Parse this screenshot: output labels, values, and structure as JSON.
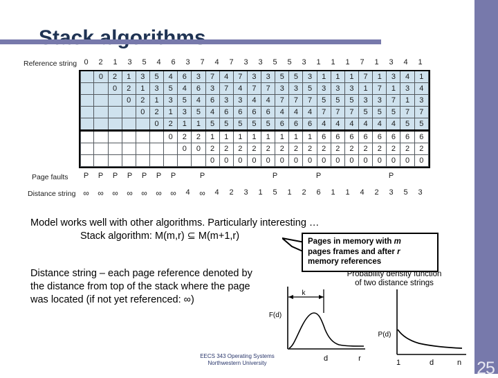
{
  "slide": {
    "title": "Stack algorithms",
    "page_number": "25",
    "accent_color": "#7779ab",
    "title_color": "#1f3353"
  },
  "figure": {
    "reference_string_label": "Reference string",
    "page_faults_label": "Page faults",
    "distance_string_label": "Distance string",
    "reference_string": [
      "0",
      "2",
      "1",
      "3",
      "5",
      "4",
      "6",
      "3",
      "7",
      "4",
      "7",
      "3",
      "3",
      "5",
      "5",
      "3",
      "1",
      "1",
      "1",
      "7",
      "1",
      "3",
      "4",
      "1"
    ],
    "page_faults": [
      "P",
      "P",
      "P",
      "P",
      "P",
      "P",
      "P",
      "",
      "P",
      "",
      "",
      "",
      "",
      "P",
      "",
      "",
      "P",
      "",
      "",
      "",
      "",
      "P",
      "",
      ""
    ],
    "distance_string": [
      "∞",
      "∞",
      "∞",
      "∞",
      "∞",
      "∞",
      "∞",
      "4",
      "∞",
      "4",
      "2",
      "3",
      "1",
      "5",
      "1",
      "2",
      "6",
      "1",
      "1",
      "4",
      "2",
      "3",
      "5",
      "3"
    ],
    "fault_marker": "P",
    "infinity_symbol": "∞",
    "memory_frames": 4,
    "rows": [
      [
        "",
        "0",
        "2",
        "1",
        "3",
        "5",
        "4",
        "6",
        "3",
        "7",
        "4",
        "7",
        "3",
        "3",
        "5",
        "5",
        "3",
        "1",
        "1",
        "1",
        "7",
        "1",
        "3",
        "4",
        "1"
      ],
      [
        "",
        "",
        "0",
        "2",
        "1",
        "3",
        "5",
        "4",
        "6",
        "3",
        "7",
        "4",
        "7",
        "7",
        "3",
        "3",
        "5",
        "3",
        "3",
        "3",
        "1",
        "7",
        "1",
        "3",
        "4"
      ],
      [
        "",
        "",
        "",
        "0",
        "2",
        "1",
        "3",
        "5",
        "4",
        "6",
        "3",
        "3",
        "4",
        "4",
        "7",
        "7",
        "7",
        "5",
        "5",
        "5",
        "3",
        "3",
        "7",
        "1",
        "3"
      ],
      [
        "",
        "",
        "",
        "",
        "0",
        "2",
        "1",
        "3",
        "5",
        "4",
        "6",
        "6",
        "6",
        "6",
        "4",
        "4",
        "4",
        "7",
        "7",
        "7",
        "5",
        "5",
        "5",
        "7",
        "7"
      ],
      [
        "",
        "",
        "",
        "",
        "",
        "0",
        "2",
        "1",
        "1",
        "5",
        "5",
        "5",
        "5",
        "5",
        "6",
        "6",
        "6",
        "4",
        "4",
        "4",
        "4",
        "4",
        "4",
        "5",
        "5"
      ],
      [
        "",
        "",
        "",
        "",
        "",
        "",
        "0",
        "2",
        "2",
        "1",
        "1",
        "1",
        "1",
        "1",
        "1",
        "1",
        "1",
        "6",
        "6",
        "6",
        "6",
        "6",
        "6",
        "6",
        "6"
      ],
      [
        "",
        "",
        "",
        "",
        "",
        "",
        "",
        "0",
        "0",
        "2",
        "2",
        "2",
        "2",
        "2",
        "2",
        "2",
        "2",
        "2",
        "2",
        "2",
        "2",
        "2",
        "2",
        "2",
        "2"
      ],
      [
        "",
        "",
        "",
        "",
        "",
        "",
        "",
        "",
        "",
        "0",
        "0",
        "0",
        "0",
        "0",
        "0",
        "0",
        "0",
        "0",
        "0",
        "0",
        "0",
        "0",
        "0",
        "0",
        "0"
      ]
    ],
    "shaded_rows": [
      0,
      1,
      2,
      3,
      4
    ],
    "shade_color": "#cfe2ee",
    "columns": 25
  },
  "text": {
    "model_line1": "Model works well with other algorithms. Particularly interesting …",
    "model_line2": "Stack algorithm:  M(m,r) ⊆ M(m+1,r)",
    "distance_para": "Distance string – each page reference denoted by the distance from top of the stack where the page was located (if not yet referenced: ∞)"
  },
  "callout": {
    "line1_pre": "Pages in memory with ",
    "line1_italic": "m",
    "line2_pre": "pages frames and after ",
    "line2_italic": "r",
    "line3": "memory references"
  },
  "charts_caption": {
    "line1": "Probability density function",
    "line2": "of two distance strings"
  },
  "chart_data": [
    {
      "type": "line",
      "name": "working-set-density",
      "title": "",
      "ylabel": "F(d)",
      "xlabel": "d",
      "x_tick_labels": [
        "d",
        "r"
      ],
      "annotation": "k",
      "x": [
        0,
        0.05,
        0.12,
        0.2,
        0.28,
        0.36,
        0.44,
        0.52,
        0.6,
        0.68,
        0.76,
        0.84,
        0.92,
        1.0
      ],
      "y": [
        0.0,
        0.05,
        0.28,
        0.62,
        0.86,
        0.95,
        0.86,
        0.62,
        0.36,
        0.22,
        0.16,
        0.13,
        0.12,
        0.12
      ],
      "grid": false,
      "legend": "none"
    },
    {
      "type": "line",
      "name": "thrashing-density",
      "title": "",
      "ylabel": "P(d)",
      "xlabel": "d",
      "x_tick_labels": [
        "1",
        "d",
        "n"
      ],
      "x": [
        0,
        0.06,
        0.14,
        0.24,
        0.36,
        0.5,
        0.64,
        0.78,
        0.9,
        1.0
      ],
      "y": [
        0.62,
        0.44,
        0.34,
        0.27,
        0.22,
        0.18,
        0.15,
        0.13,
        0.12,
        0.11
      ],
      "grid": false,
      "legend": "none"
    }
  ],
  "footer": {
    "line1": "EECS 343 Operating Systems",
    "line2": "Northwestern University"
  }
}
